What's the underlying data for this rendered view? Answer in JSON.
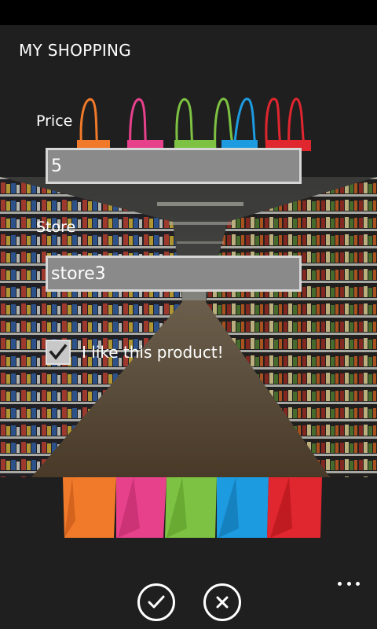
{
  "app": {
    "title": "MY SHOPPING"
  },
  "form": {
    "price_label": "Price",
    "price_value": "5",
    "store_label": "Store",
    "store_value": "store3",
    "like_label": "I like this product!",
    "like_checked": true
  },
  "app_bar": {
    "buttons": [
      {
        "icon": "check-icon"
      },
      {
        "icon": "close-icon"
      }
    ],
    "more_icon": "ellipsis-icon"
  },
  "colors": {
    "background": "#1f1f1f",
    "textbox_fill": "#8a8a8a",
    "textbox_border": "#d6d6d6",
    "bag_orange": "#f07a2a",
    "bag_pink": "#e8418c",
    "bag_green": "#7dc242",
    "bag_blue": "#1d9be0",
    "bag_red": "#e0262e"
  }
}
